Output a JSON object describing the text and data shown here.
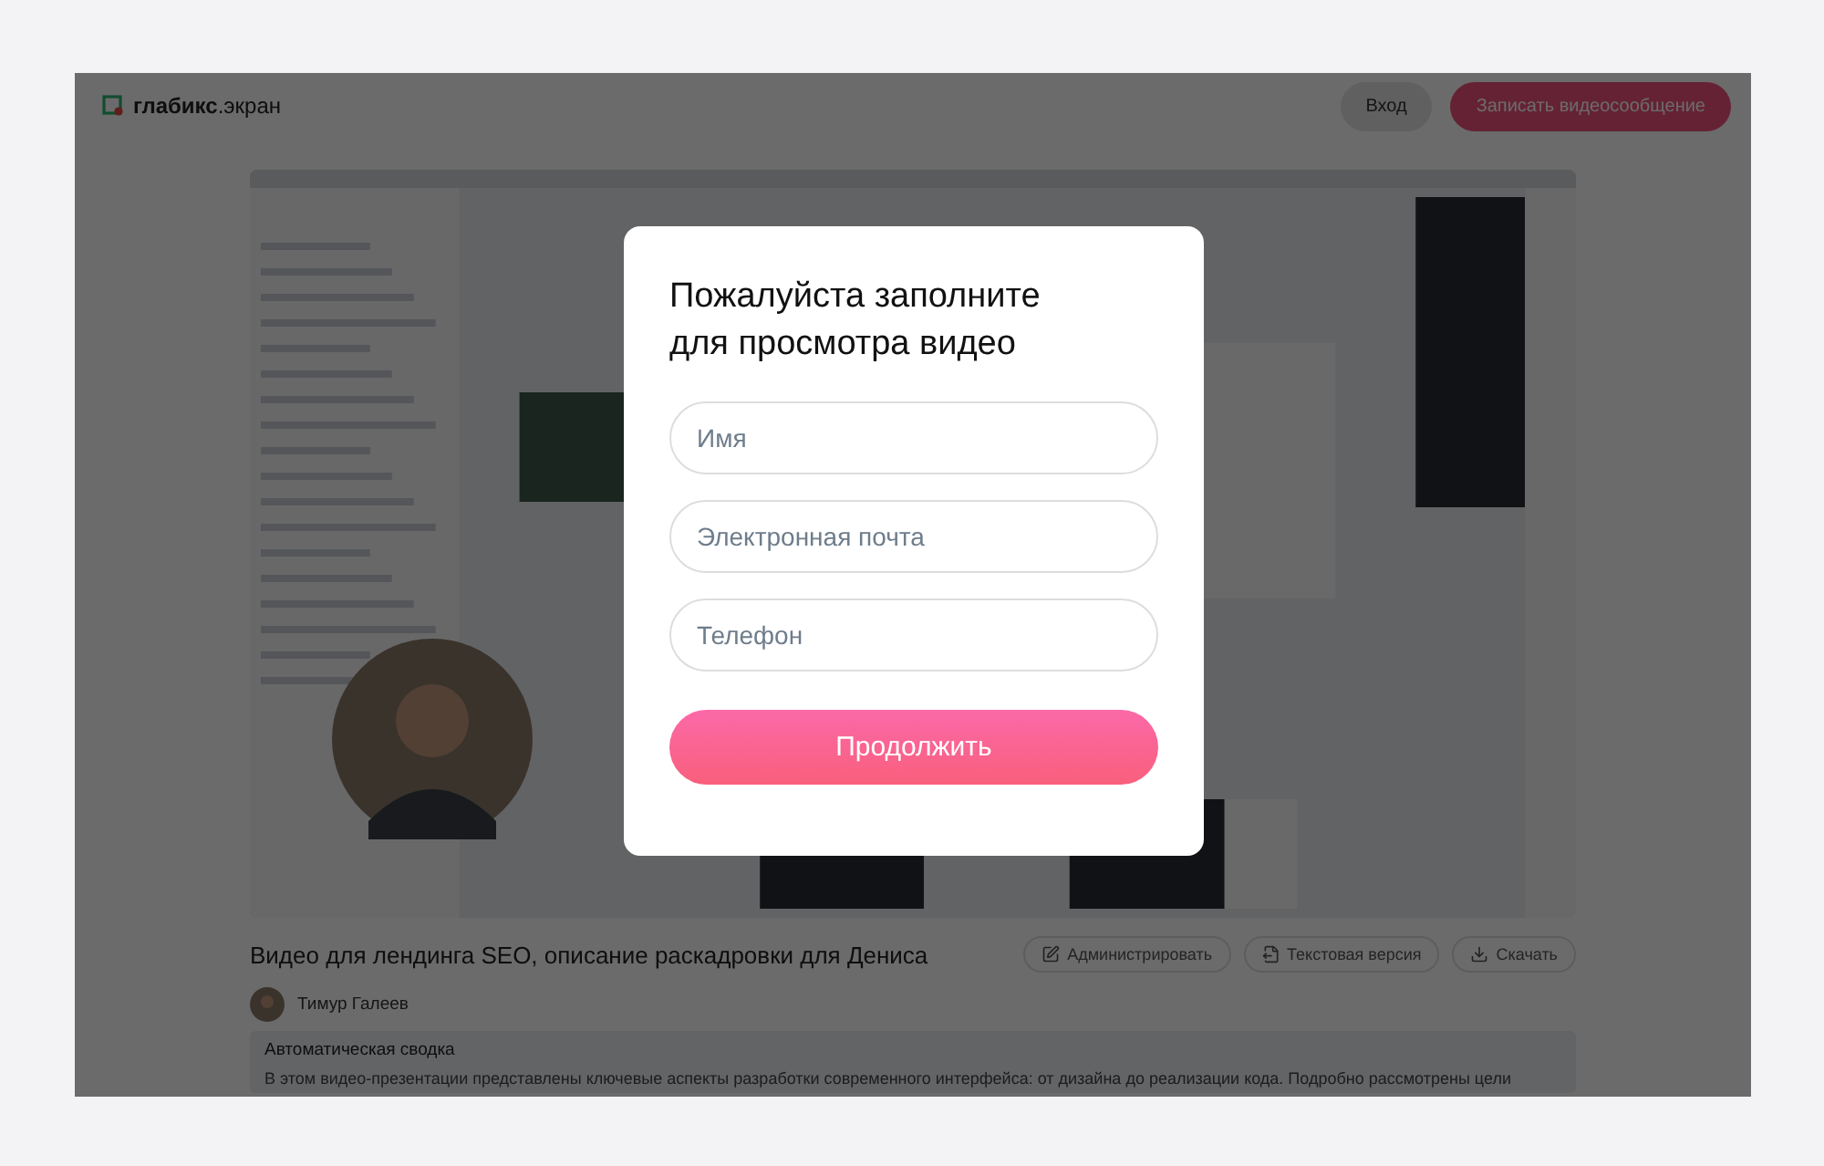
{
  "header": {
    "logo": {
      "brand": "глабикс",
      "suffix": ".экран"
    },
    "buttons": [
      {
        "label": "Вход",
        "kind": "secondary"
      },
      {
        "label": "Записать видеосообщение",
        "kind": "primary"
      }
    ]
  },
  "video_title": "Видео для лендинга SEO, описание раскадровки для Дениса",
  "actions": [
    {
      "label": "Администрировать"
    },
    {
      "label": "Текстовая версия"
    },
    {
      "label": "Скачать"
    }
  ],
  "author": {
    "name": "Тимур Галеев"
  },
  "summary": {
    "title": "Автоматическая сводка",
    "text": "В этом видео-презентации представлены ключевые аспекты разработки современного интерфейса: от дизайна до реализации кода. Подробно рассмотрены цели"
  },
  "modal": {
    "title": "Пожалуйста заполните для просмотра видео",
    "fields": [
      {
        "placeholder": "Имя"
      },
      {
        "placeholder": "Электронная почта"
      },
      {
        "placeholder": "Телефон"
      }
    ],
    "submit": "Продолжить"
  }
}
